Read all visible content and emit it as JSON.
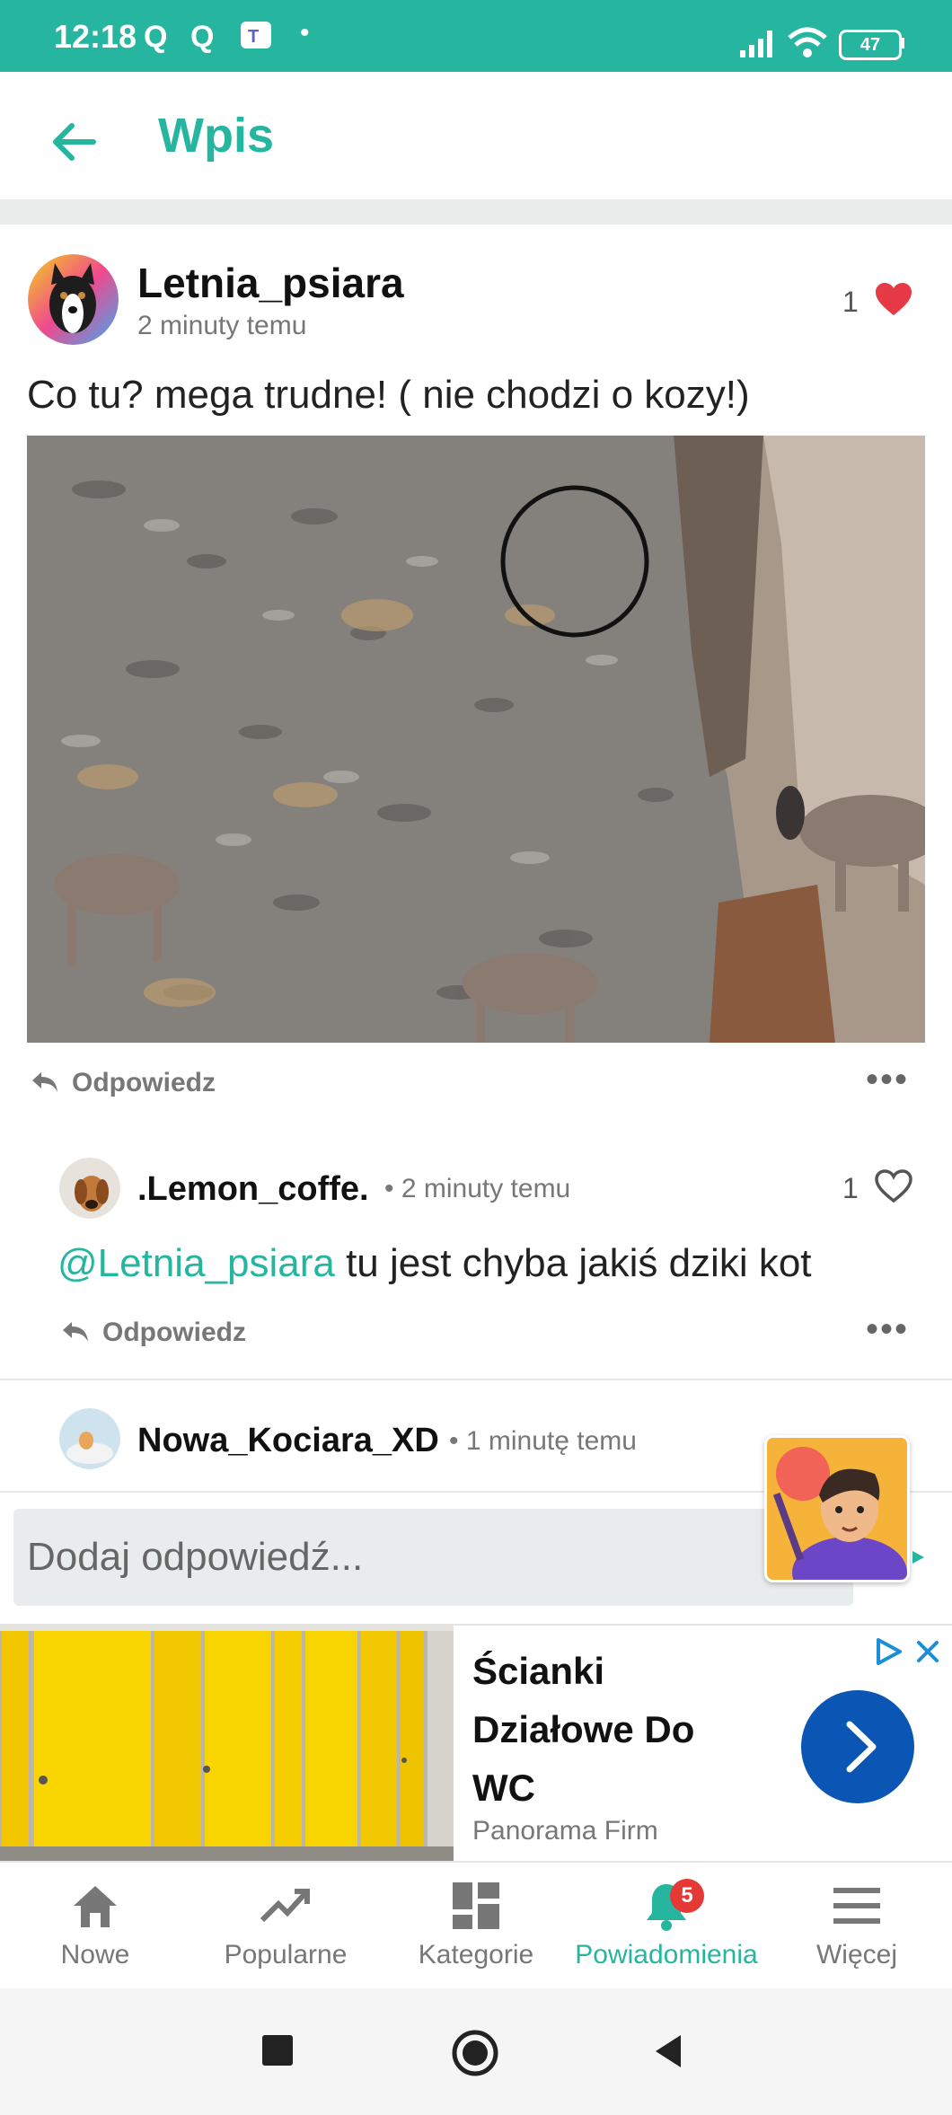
{
  "status_bar": {
    "time": "12:18",
    "notif_q1": "Q",
    "notif_q2": "Q",
    "dot": "•",
    "battery": "47"
  },
  "header": {
    "title": "Wpis"
  },
  "post": {
    "username": "Letnia_psiara",
    "time": "2 minuty temu",
    "likes": "1",
    "text": "Co tu? mega trudne! ( nie chodzi o kozy!)",
    "reply_label": "Odpowiedz",
    "more": "•••"
  },
  "comments": [
    {
      "username": ".Lemon_coffe.",
      "time": "• 2 minuty temu",
      "likes": "1",
      "mention": "@Letnia_psiara",
      "text": " tu jest chyba jakiś dziki kot",
      "reply_label": "Odpowiedz",
      "more": "•••"
    },
    {
      "username": "Nowa_Kociara_XD",
      "time": "• 1 minutę temu"
    }
  ],
  "reply_input": {
    "placeholder": "Dodaj odpowiedź..."
  },
  "ad": {
    "title": "Ścianki Działowe Do WC",
    "brand": "Panorama Firm"
  },
  "bottom_nav": {
    "items": [
      {
        "label": "Nowe",
        "icon": "home-icon"
      },
      {
        "label": "Popularne",
        "icon": "trending-icon"
      },
      {
        "label": "Kategorie",
        "icon": "grid-icon"
      },
      {
        "label": "Powiadomienia",
        "icon": "bell-icon",
        "badge": "5",
        "active": true
      },
      {
        "label": "Więcej",
        "icon": "menu-icon"
      }
    ]
  },
  "colors": {
    "accent": "#26b59e",
    "like_red": "#e53945",
    "ad_button": "#0b55b4"
  }
}
